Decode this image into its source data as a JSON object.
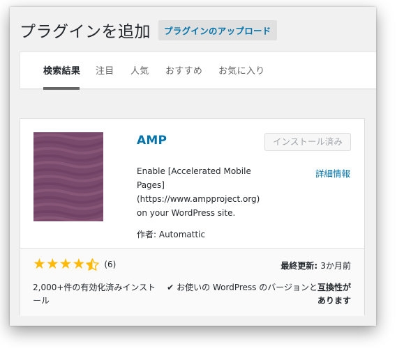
{
  "header": {
    "title": "プラグインを追加",
    "upload_button": "プラグインのアップロード"
  },
  "tabs": [
    {
      "label": "検索結果",
      "current": true
    },
    {
      "label": "注目",
      "current": false
    },
    {
      "label": "人気",
      "current": false
    },
    {
      "label": "おすすめ",
      "current": false
    },
    {
      "label": "お気に入り",
      "current": false
    }
  ],
  "plugin": {
    "name": "AMP",
    "install_button": "インストール済み",
    "more_details": "詳細情報",
    "description": "Enable [Accelerated Mobile Pages] (https://www.ampproject.org) on your WordPress site.",
    "author_label": "作者: ",
    "author_name": "Automattic",
    "rating_stars": 4.5,
    "rating_count": "(6)",
    "active_installs": "2,000+件の有効化済みインストール",
    "last_updated_label": "最終更新: ",
    "last_updated_value": "3か月前",
    "compat_prefix": "お使いの WordPress のバージョンと",
    "compat_bold": "互換性があります",
    "icon_name": "plugin-banner-icon",
    "check_icon": "checkmark-icon"
  },
  "colors": {
    "link": "#0073aa",
    "star": "#ffb900",
    "banner_base": "#7a4a6d",
    "banner_light": "#94627f",
    "banner_dark": "#6b3d60"
  }
}
